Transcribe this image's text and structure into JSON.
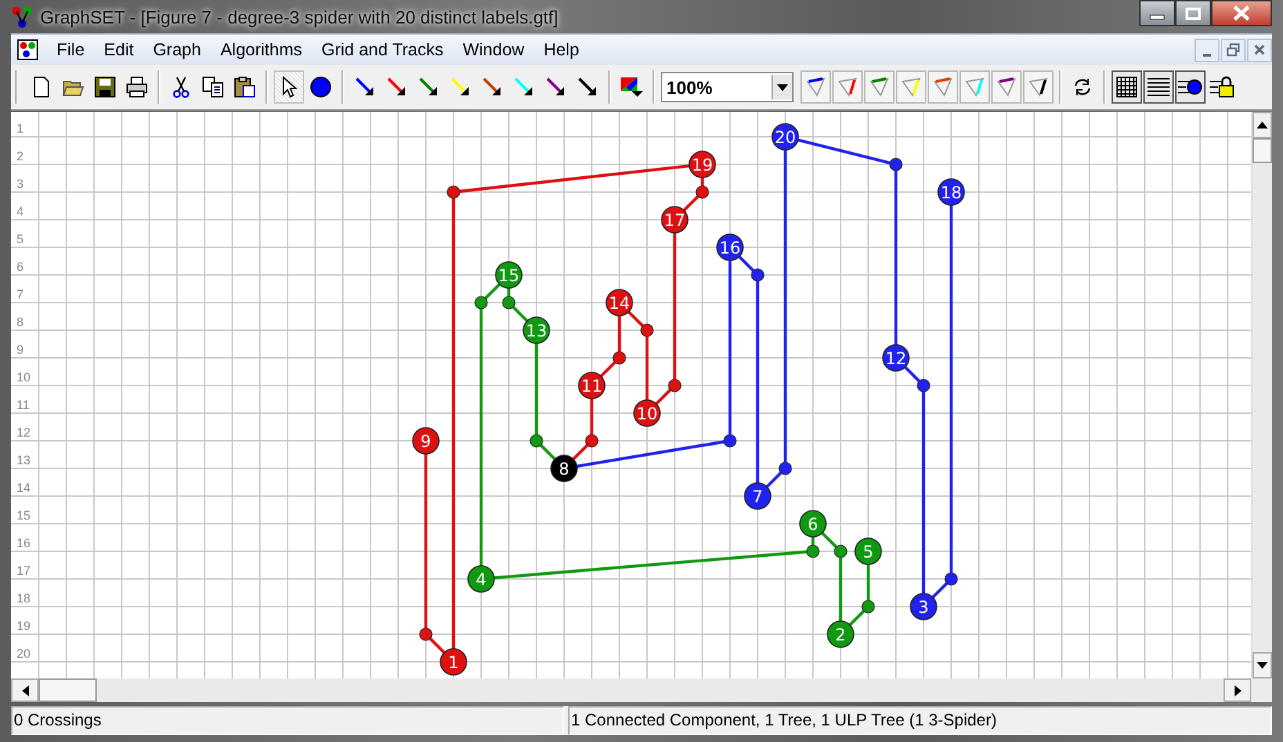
{
  "window": {
    "title": "GraphSET - [Figure 7 - degree-3 spider with 20 distinct labels.gtf]"
  },
  "menu": [
    "File",
    "Edit",
    "Graph",
    "Algorithms",
    "Grid and Tracks",
    "Window",
    "Help"
  ],
  "toolbar": {
    "tools": [
      {
        "kind": "pointer",
        "selected": true
      },
      {
        "kind": "node",
        "selected": false
      }
    ],
    "edge_colors": [
      {
        "color": "#0000ff"
      },
      {
        "color": "#ff0000"
      },
      {
        "color": "#008000"
      },
      {
        "color": "#ffff00"
      },
      {
        "color": "#c04000"
      },
      {
        "color": "#00ffff"
      },
      {
        "color": "#800080"
      },
      {
        "color": "#000000"
      }
    ],
    "zoom": "100%",
    "track_colors": [
      {
        "color": "#0000ff"
      },
      {
        "color": "#ff0000"
      },
      {
        "color": "#008000"
      },
      {
        "color": "#ffff00"
      },
      {
        "color": "#e04000"
      },
      {
        "color": "#00ffff"
      },
      {
        "color": "#800080"
      },
      {
        "color": "#000000"
      }
    ]
  },
  "canvas": {
    "row_numbers": [
      "1",
      "2",
      "3",
      "4",
      "5",
      "6",
      "7",
      "8",
      "9",
      "10",
      "11",
      "12",
      "13",
      "14",
      "15",
      "16",
      "17",
      "18",
      "19",
      "20"
    ],
    "graph": {
      "nodes": [
        {
          "label": "1",
          "color": "#dd1111"
        },
        {
          "label": "2",
          "color": "#119911"
        },
        {
          "label": "3",
          "color": "#2222ee"
        },
        {
          "label": "4",
          "color": "#119911"
        },
        {
          "label": "5",
          "color": "#119911"
        },
        {
          "label": "6",
          "color": "#119911"
        },
        {
          "label": "7",
          "color": "#2222ee"
        },
        {
          "label": "8",
          "color": "#000000"
        },
        {
          "label": "9",
          "color": "#dd1111"
        },
        {
          "label": "10",
          "color": "#dd1111"
        },
        {
          "label": "11",
          "color": "#dd1111"
        },
        {
          "label": "12",
          "color": "#2222ee"
        },
        {
          "label": "13",
          "color": "#119911"
        },
        {
          "label": "14",
          "color": "#dd1111"
        },
        {
          "label": "15",
          "color": "#119911"
        },
        {
          "label": "16",
          "color": "#2222ee"
        },
        {
          "label": "17",
          "color": "#dd1111"
        },
        {
          "label": "18",
          "color": "#2222ee"
        },
        {
          "label": "19",
          "color": "#dd1111"
        },
        {
          "label": "20",
          "color": "#2222ee"
        }
      ]
    }
  },
  "status_bar": [
    "0 Crossings",
    "1 Connected Component, 1 Tree, 1 ULP Tree (1 3-Spider)"
  ]
}
